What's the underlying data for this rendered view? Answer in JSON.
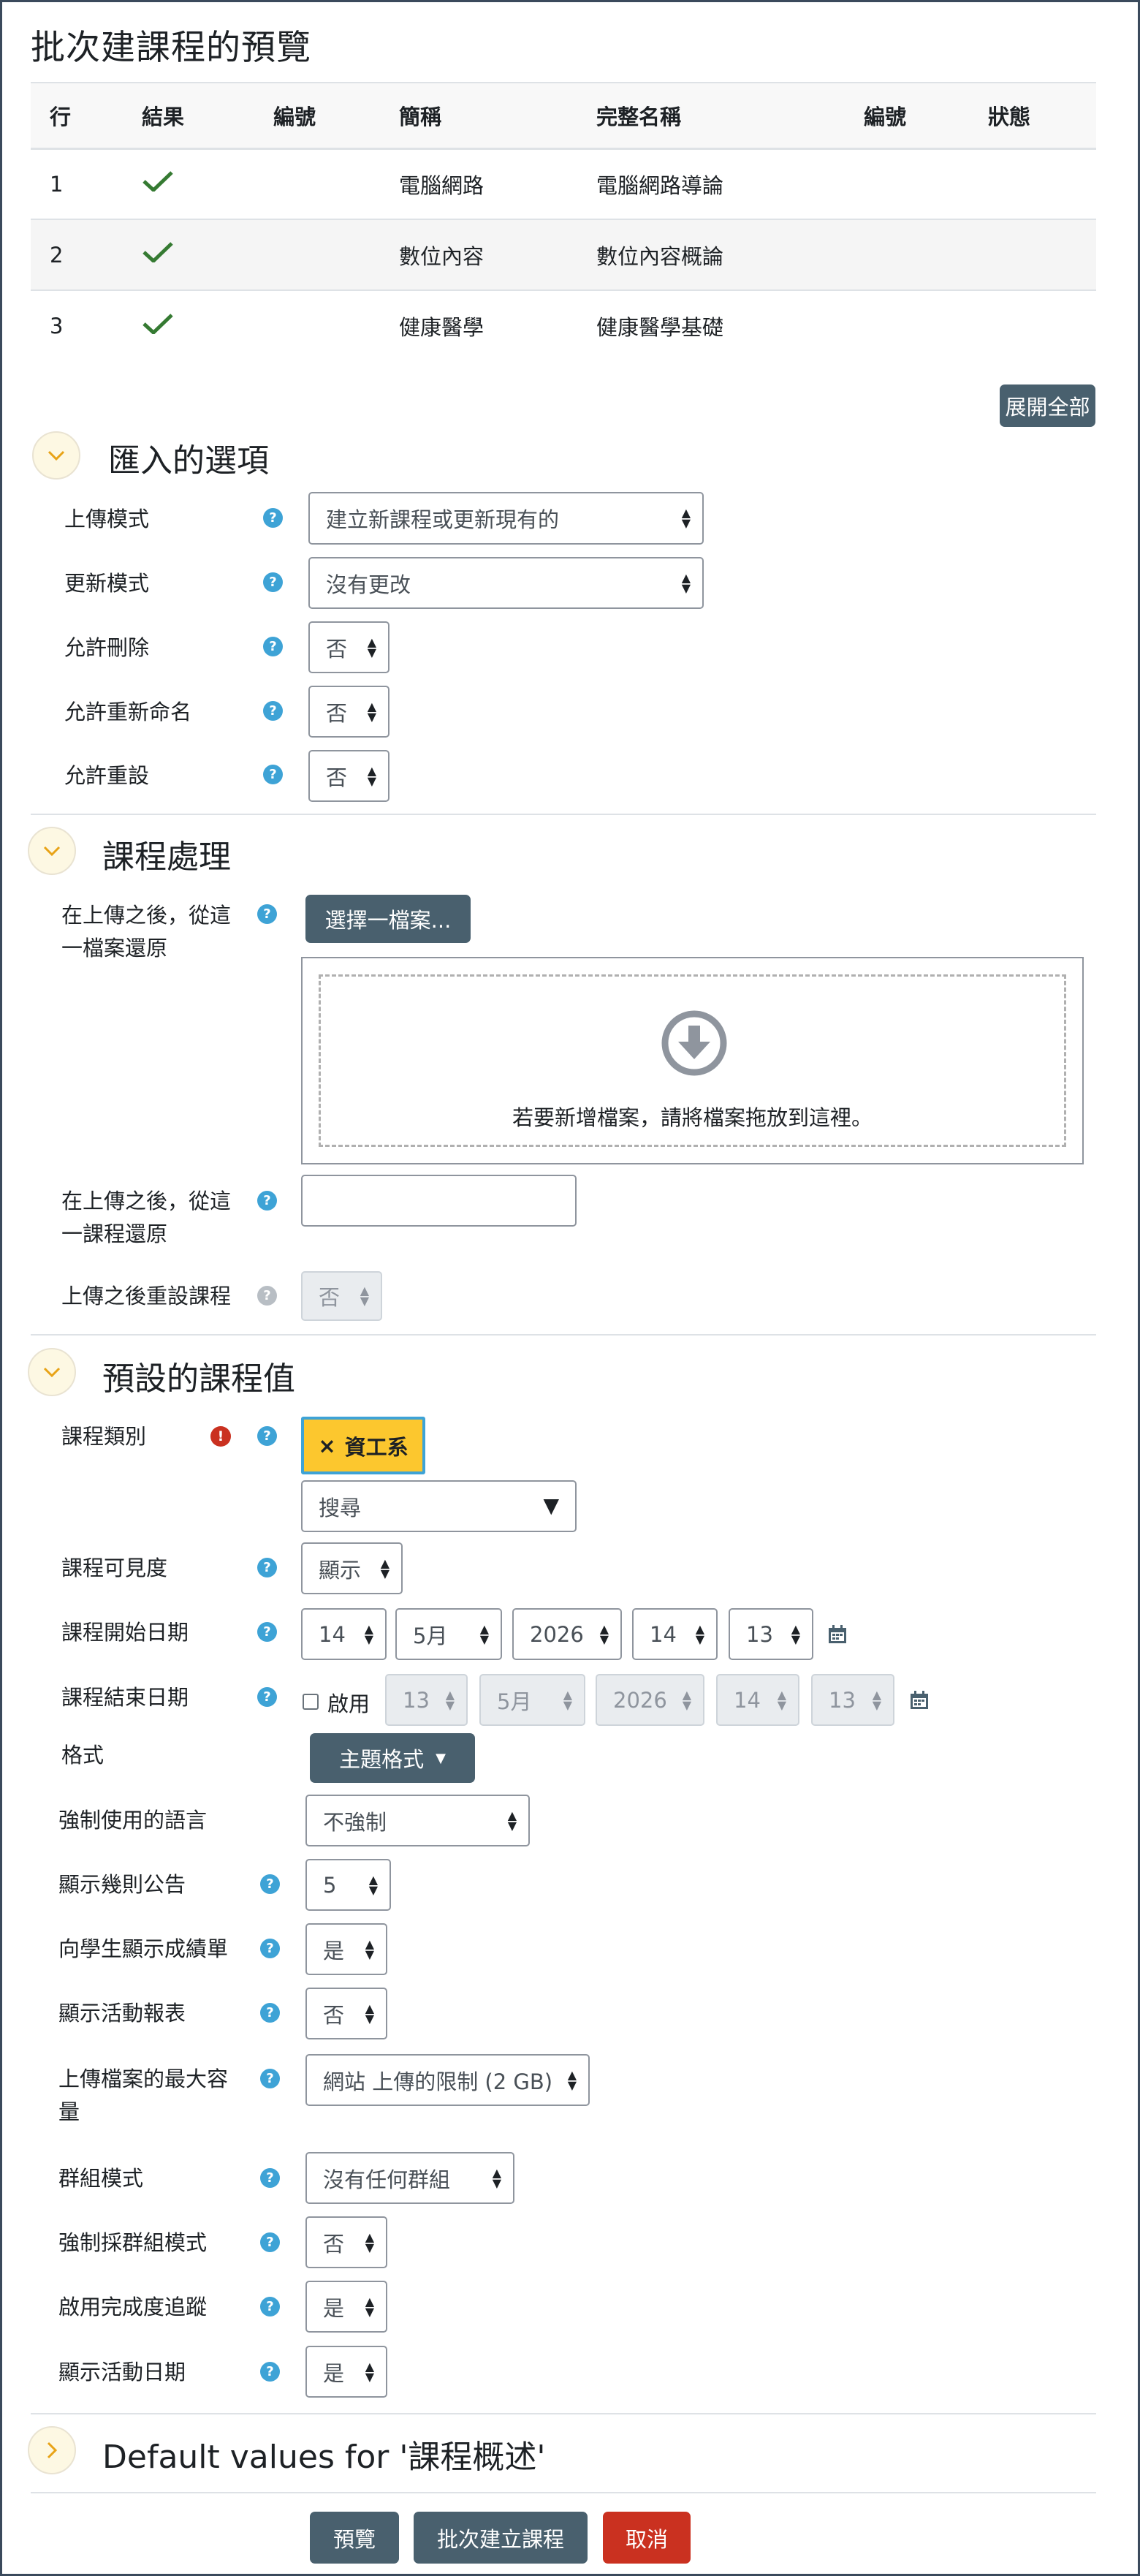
{
  "page": {
    "title": "批次建課程的預覽"
  },
  "table": {
    "headers": [
      "行",
      "結果",
      "編號",
      "簡稱",
      "完整名稱",
      "編號",
      "狀態"
    ],
    "rows": [
      {
        "line": "1",
        "short": "電腦網路",
        "full": "電腦網路導論"
      },
      {
        "line": "2",
        "short": "數位內容",
        "full": "數位內容概論"
      },
      {
        "line": "3",
        "short": "健康醫學",
        "full": "健康醫學基礎"
      }
    ]
  },
  "expand_all": "展開全部",
  "import_options": {
    "title": "匯入的選項",
    "upload_mode": {
      "label": "上傳模式",
      "value": "建立新課程或更新現有的"
    },
    "update_mode": {
      "label": "更新模式",
      "value": "沒有更改"
    },
    "allow_delete": {
      "label": "允許刪除",
      "value": "否"
    },
    "allow_rename": {
      "label": "允許重新命名",
      "value": "否"
    },
    "allow_reset": {
      "label": "允許重設",
      "value": "否"
    }
  },
  "course_process": {
    "title": "課程處理",
    "restore_file": {
      "label": "在上傳之後，從這一檔案還原",
      "button": "選擇一檔案...",
      "drop_text": "若要新增檔案，請將檔案拖放到這裡。"
    },
    "restore_course": {
      "label": "在上傳之後，從這一課程還原",
      "value": ""
    },
    "reset_after": {
      "label": "上傳之後重設課程",
      "value": "否"
    }
  },
  "defaults": {
    "title": "預設的課程值",
    "category": {
      "label": "課程類別",
      "tag": "資工系",
      "search_placeholder": "搜尋"
    },
    "visibility": {
      "label": "課程可見度",
      "value": "顯示"
    },
    "start_date": {
      "label": "課程開始日期",
      "day": "14",
      "month": "5月",
      "year": "2026",
      "hour": "14",
      "minute": "13"
    },
    "end_date": {
      "label": "課程結束日期",
      "enable": "啟用",
      "day": "13",
      "month": "5月",
      "year": "2026",
      "hour": "14",
      "minute": "13"
    },
    "format": {
      "label": "格式",
      "button": "主題格式"
    },
    "force_lang": {
      "label": "強制使用的語言",
      "value": "不強制"
    },
    "news_items": {
      "label": "顯示幾則公告",
      "value": "5"
    },
    "show_grades": {
      "label": "向學生顯示成績單",
      "value": "是"
    },
    "show_reports": {
      "label": "顯示活動報表",
      "value": "否"
    },
    "max_bytes": {
      "label": "上傳檔案的最大容量",
      "value": "網站 上傳的限制 (2 GB)"
    },
    "group_mode": {
      "label": "群組模式",
      "value": "沒有任何群組"
    },
    "force_group": {
      "label": "強制採群組模式",
      "value": "否"
    },
    "completion": {
      "label": "啟用完成度追蹤",
      "value": "是"
    },
    "activity_dates": {
      "label": "顯示活動日期",
      "value": "是"
    }
  },
  "summary_section": {
    "title": "Default values for '課程概述'"
  },
  "footer": {
    "preview": "預覽",
    "upload": "批次建立課程",
    "cancel": "取消"
  },
  "colors": {
    "button": "#49606e",
    "cancel": "#ca3120",
    "help": "#3ea3d6",
    "tag": "#fcc72e",
    "check": "#357a32"
  }
}
